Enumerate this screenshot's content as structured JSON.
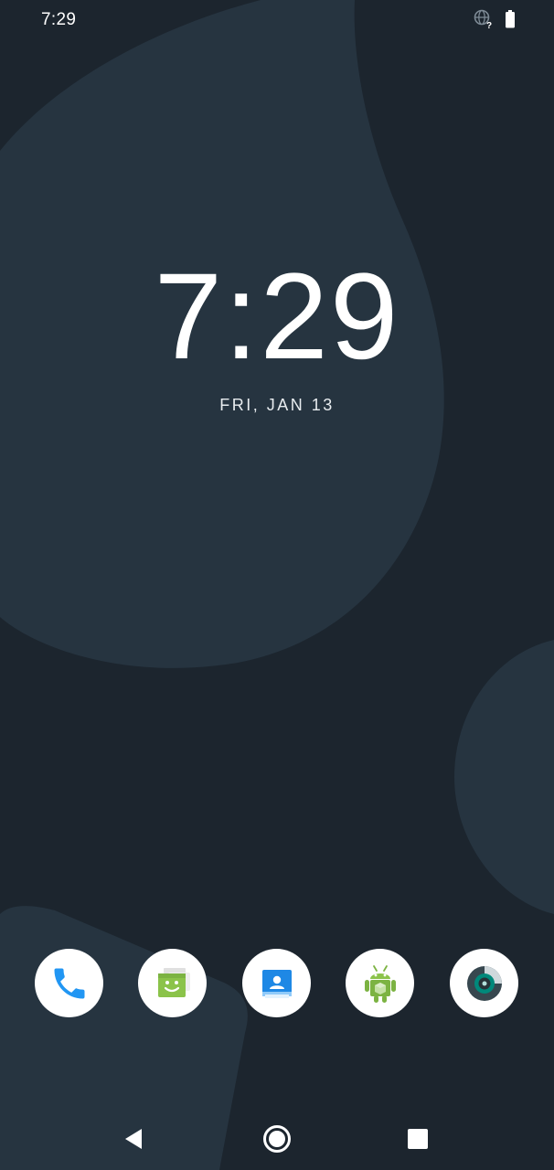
{
  "status_bar": {
    "time": "7:29",
    "icons": [
      "network-unknown-icon",
      "battery-icon"
    ]
  },
  "lockscreen": {
    "clock": "7:29",
    "date": "FRI, JAN 13"
  },
  "dock": {
    "apps": [
      {
        "name": "phone-app-icon"
      },
      {
        "name": "messaging-app-icon"
      },
      {
        "name": "contacts-app-icon"
      },
      {
        "name": "android-app-icon"
      },
      {
        "name": "camera-app-icon"
      }
    ]
  },
  "nav_bar": {
    "buttons": [
      "back-icon",
      "home-icon",
      "recents-icon"
    ]
  },
  "colors": {
    "background": "#1c252e",
    "blob": "#263440",
    "text": "#ffffff",
    "phone_blue": "#2196f3",
    "messaging_green": "#8bc34a",
    "contacts_blue": "#1e88e5",
    "android_green": "#7cb342",
    "camera_teal": "#00897b"
  }
}
